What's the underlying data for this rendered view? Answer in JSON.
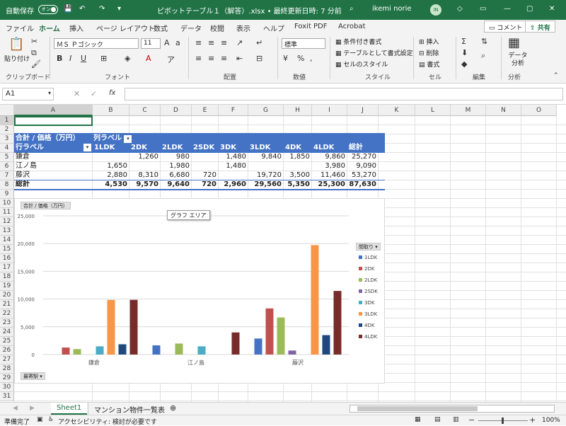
{
  "titlebar": {
    "autosave_label": "自動保存",
    "autosave_state": "オン",
    "file_title": "ピボットテーブル１（解答）.xlsx • 最終更新日時: 7 分前",
    "user_name": "ikemi norie",
    "user_initials": "IN"
  },
  "tabs": [
    "ファイル",
    "ホーム",
    "挿入",
    "ページ レイアウト",
    "数式",
    "データ",
    "校閲",
    "表示",
    "ヘルプ",
    "Foxit PDF",
    "Acrobat"
  ],
  "share": {
    "comment_label": "コメント",
    "share_label": "共有"
  },
  "ribbon": {
    "paste_label": "貼り付け",
    "font_name": "ＭＳ Ｐゴシック",
    "font_size": "11",
    "number_format": "標準",
    "cond_format": "条件付き書式",
    "table_format": "テーブルとして書式設定",
    "cell_style": "セルのスタイル",
    "insert": "挿入",
    "delete": "削除",
    "format": "書式",
    "analyze": "データ分析",
    "groups": [
      "クリップボード",
      "フォント",
      "配置",
      "数値",
      "スタイル",
      "セル",
      "編集",
      "分析"
    ]
  },
  "formula_bar": {
    "name_box": "A1",
    "fx": "fx",
    "formula": ""
  },
  "columns": [
    "A",
    "B",
    "C",
    "D",
    "E",
    "F",
    "G",
    "H",
    "I",
    "J",
    "K",
    "L",
    "M",
    "N",
    "O"
  ],
  "rows": [
    "1",
    "2",
    "3",
    "4",
    "5",
    "6",
    "7",
    "8",
    "9",
    "10",
    "11",
    "12",
    "13",
    "14",
    "15",
    "16",
    "17",
    "18",
    "19",
    "20",
    "21",
    "22",
    "23",
    "24",
    "25",
    "26",
    "27",
    "28",
    "29",
    "30",
    "31"
  ],
  "pivot": {
    "corner": "合計 / 価格（万円）",
    "col_labels": "列ラベル",
    "row_labels": "行ラベル",
    "headers": [
      "1LDK",
      "2DK",
      "2LDK",
      "2SDK",
      "3DK",
      "3LDK",
      "4DK",
      "4LDK",
      "総計"
    ],
    "data": [
      {
        "label": "鎌倉",
        "cells": [
          "",
          "1,260",
          "980",
          "",
          "1,480",
          "9,840",
          "1,850",
          "9,860",
          "25,270"
        ]
      },
      {
        "label": "江ノ島",
        "cells": [
          "1,650",
          "",
          "1,980",
          "",
          "1,480",
          "",
          "",
          "3,980",
          "9,090"
        ]
      },
      {
        "label": "藤沢",
        "cells": [
          "2,880",
          "8,310",
          "6,680",
          "720",
          "",
          "19,720",
          "3,500",
          "11,460",
          "53,270"
        ]
      }
    ],
    "total": {
      "label": "総計",
      "cells": [
        "4,530",
        "9,570",
        "9,640",
        "720",
        "2,960",
        "29,560",
        "5,350",
        "25,300",
        "87,630"
      ]
    }
  },
  "chart_data": {
    "type": "bar",
    "categories": [
      "鎌倉",
      "江ノ島",
      "藤沢"
    ],
    "ylim": [
      0,
      25000
    ],
    "yticks": [
      "0",
      "5,000",
      "10,000",
      "15,000",
      "20,000",
      "25,000"
    ],
    "value_field_button": "合計 / 価格（万円）",
    "legend_button": "間取り",
    "axis_field_button": "最寄駅",
    "tooltip": "グラフ エリア",
    "series": [
      {
        "name": "1LDK",
        "color": "#4472c4",
        "values": [
          0,
          1650,
          2880
        ]
      },
      {
        "name": "2DK",
        "color": "#c0504d",
        "values": [
          1260,
          0,
          8310
        ]
      },
      {
        "name": "2LDK",
        "color": "#9bbb59",
        "values": [
          980,
          1980,
          6680
        ]
      },
      {
        "name": "2SDK",
        "color": "#8064a2",
        "values": [
          0,
          0,
          720
        ]
      },
      {
        "name": "3DK",
        "color": "#4bacc6",
        "values": [
          1480,
          1480,
          0
        ]
      },
      {
        "name": "3LDK",
        "color": "#f79646",
        "values": [
          9840,
          0,
          19720
        ]
      },
      {
        "name": "4DK",
        "color": "#1f497d",
        "values": [
          1850,
          0,
          3500
        ]
      },
      {
        "name": "4LDK",
        "color": "#772c2a",
        "values": [
          9860,
          3980,
          11460
        ]
      }
    ]
  },
  "sheets": {
    "active": "Sheet1",
    "other": "マンション物件一覧表"
  },
  "status": {
    "ready": "準備完了",
    "accessibility": "アクセシビリティ: 検討が必要です",
    "zoom": "100%"
  }
}
